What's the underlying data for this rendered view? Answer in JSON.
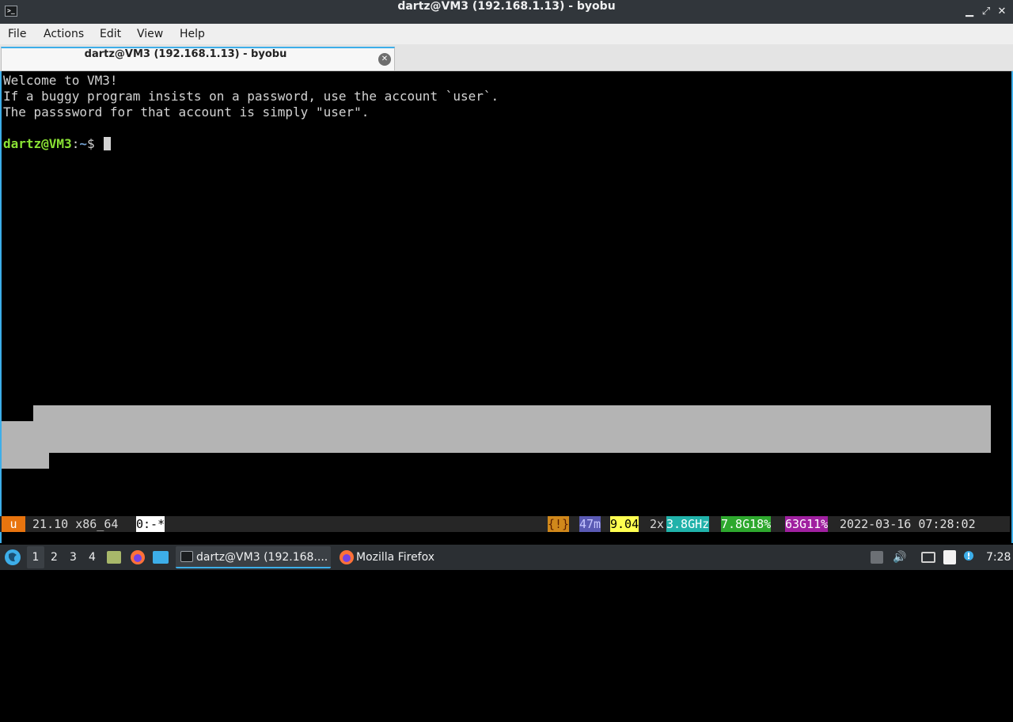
{
  "window": {
    "title": "dartz@VM3 (192.168.1.13) - byobu",
    "icon_glyph": ">_",
    "buttons": {
      "minimize": "▁",
      "maximize": "⤢",
      "close": "✕"
    }
  },
  "menu": {
    "file": "File",
    "actions": "Actions",
    "edit": "Edit",
    "view": "View",
    "help": "Help"
  },
  "tab": {
    "label": "dartz@VM3 (192.168.1.13) - byobu",
    "close_glyph": "✕"
  },
  "terminal": {
    "lines": [
      "Welcome to VM3!",
      "If a buggy program insists on a password, use the account `user`.",
      "The passsword for that account is simply \"user\"."
    ],
    "prompt": {
      "user_host": "dartz@VM3",
      "colon": ":",
      "path": "~",
      "symbol": "$ "
    }
  },
  "statusbar": {
    "user_badge": "u",
    "release": " 21.10 x86_64 ",
    "window_index": "0:-*",
    "alert": "{!}",
    "uptime": "47m",
    "load": "9.04",
    "cpu_count": " 2x",
    "cpu_freq": "3.8GHz",
    "mem": "7.8G18%",
    "disk": "63G11%",
    "datetime": " 2022-03-16 07:28:02",
    "colors": {
      "user_badge": "#e8740e",
      "window_index": "#ffffff",
      "alert": "#d0881b",
      "uptime": "#5a5ab4",
      "load": "#ffff50",
      "cpu_freq": "#20b2aa",
      "mem": "#2ea82e",
      "disk": "#a020a0"
    }
  },
  "taskbar": {
    "workspaces": [
      "1",
      "2",
      "3",
      "4"
    ],
    "active_workspace": "1",
    "windows": [
      {
        "label": "dartz@VM3 (192.168....",
        "icon": "terminal-icon"
      },
      {
        "label": "Mozilla Firefox",
        "icon": "firefox-icon"
      }
    ],
    "clock": "7:28",
    "accent": "#3daee9"
  }
}
